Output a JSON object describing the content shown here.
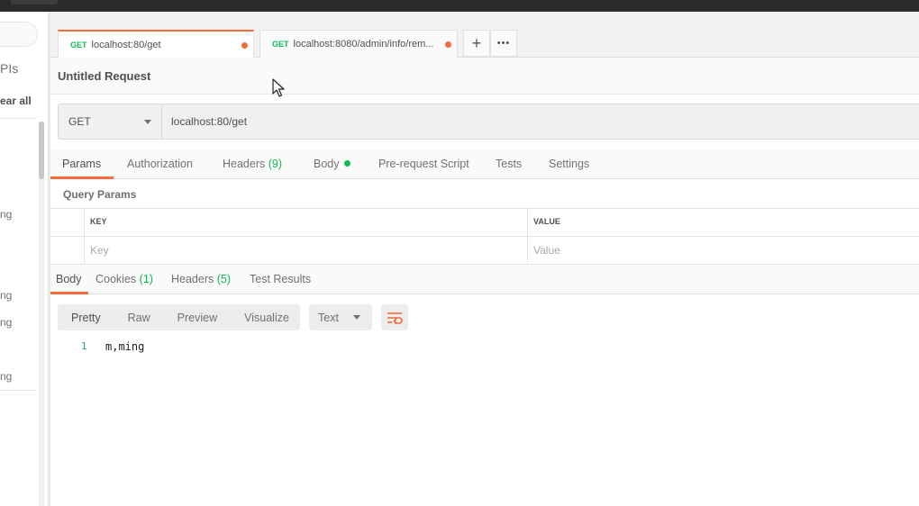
{
  "sidebar": {
    "apis_label": "PIs",
    "clear_all_label": "ear all",
    "items": [
      "ng",
      "ng",
      "ng",
      "ng"
    ]
  },
  "tabs": [
    {
      "method": "GET",
      "label": "localhost:80/get",
      "unsaved": true,
      "active": true
    },
    {
      "method": "GET",
      "label": "localhost:8080/admin/info/rem...",
      "unsaved": true,
      "active": false
    }
  ],
  "tab_actions": {
    "new_tab_icon": "+",
    "more_icon": "•••"
  },
  "request": {
    "title": "Untitled Request",
    "method": "GET",
    "url": "localhost:80/get"
  },
  "request_tabs": {
    "params": "Params",
    "authorization": "Authorization",
    "headers": "Headers",
    "headers_count": "(9)",
    "body": "Body",
    "prerequest": "Pre-request Script",
    "tests": "Tests",
    "settings": "Settings"
  },
  "query_params": {
    "title": "Query Params",
    "key_header": "KEY",
    "value_header": "VALUE",
    "key_placeholder": "Key",
    "value_placeholder": "Value"
  },
  "response_tabs": {
    "body": "Body",
    "cookies": "Cookies",
    "cookies_count": "(1)",
    "headers": "Headers",
    "headers_count": "(5)",
    "test_results": "Test Results"
  },
  "viewer": {
    "modes": [
      "Pretty",
      "Raw",
      "Preview",
      "Visualize"
    ],
    "format": "Text"
  },
  "response_body": {
    "line_number": "1",
    "line_text": "m,ming"
  },
  "colors": {
    "accent": "#f26b3a",
    "get_method": "#0cbb52",
    "count": "#0cbb52"
  }
}
